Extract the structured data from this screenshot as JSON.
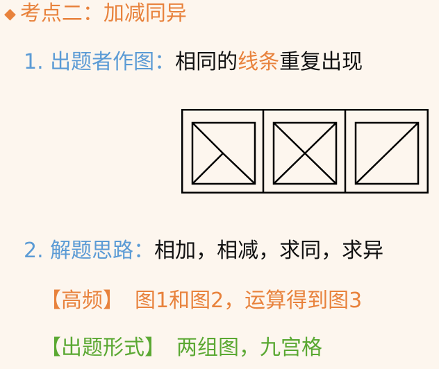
{
  "heading": {
    "bullet": "◆",
    "text": "考点二：加减同异"
  },
  "point1": {
    "label": "1. 出题者作图：",
    "text_before": "相同的",
    "highlight": "线条",
    "text_after": "重复出现"
  },
  "figure": {
    "panels": [
      {
        "description": "triangle"
      },
      {
        "description": "square-x"
      },
      {
        "description": "slash"
      }
    ]
  },
  "point2": {
    "label": "2. 解题思路：",
    "text": "相加，相减，求同，求异"
  },
  "frequency": {
    "tag": "【高频】",
    "text": "图1和图2，运算得到图3"
  },
  "form": {
    "tag": "【出题形式】",
    "text": "两组图，九宫格"
  },
  "colors": {
    "heading": "#e8823c",
    "label": "#5b9bd5",
    "highlight": "#e8823c",
    "form_tag": "#5aa832"
  }
}
